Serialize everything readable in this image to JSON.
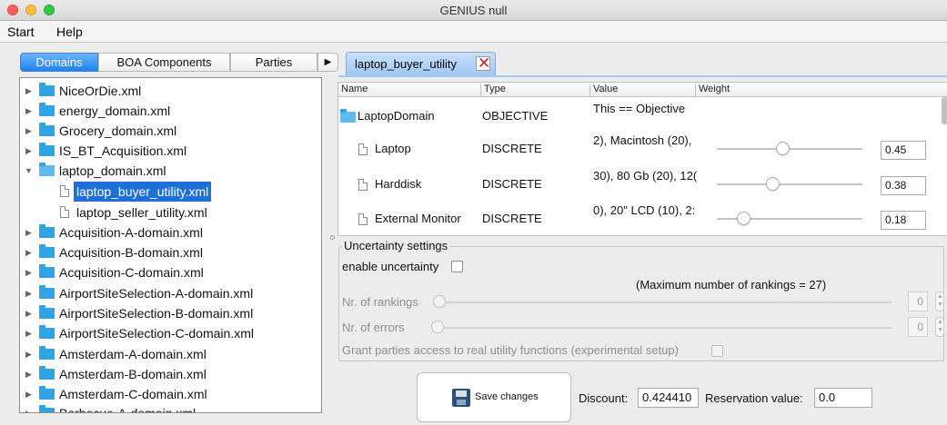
{
  "window": {
    "title": "GENIUS null"
  },
  "menu": {
    "items": [
      "Start",
      "Help"
    ]
  },
  "left_tabs": {
    "domains": "Domains",
    "boa": "BOA Components",
    "parties": "Parties",
    "more": "▶"
  },
  "tree": [
    "NiceOrDie.xml",
    "energy_domain.xml",
    "Grocery_domain.xml",
    "IS_BT_Acquisition.xml",
    "laptop_domain.xml",
    "laptop_buyer_utility.xml",
    "laptop_seller_utility.xml",
    "Acquisition-A-domain.xml",
    "Acquisition-B-domain.xml",
    "Acquisition-C-domain.xml",
    "AirportSiteSelection-A-domain.xml",
    "AirportSiteSelection-B-domain.xml",
    "AirportSiteSelection-C-domain.xml",
    "Amsterdam-A-domain.xml",
    "Amsterdam-B-domain.xml",
    "Amsterdam-C-domain.xml",
    "Barbecue-A-domain.xml"
  ],
  "editor_tab": {
    "label": "laptop_buyer_utility"
  },
  "table": {
    "headers": [
      "Name",
      "Type",
      "Value",
      "Weight"
    ],
    "rows": [
      {
        "name": "LaptopDomain",
        "type": "OBJECTIVE",
        "value": "This == Objective",
        "weight": ""
      },
      {
        "name": "Laptop",
        "type": "DISCRETE",
        "value": "2), Macintosh (20),",
        "weight": "0.45",
        "level": 0.45
      },
      {
        "name": "Harddisk",
        "type": "DISCRETE",
        "value": "30), 80 Gb (20), 12(",
        "weight": "0.38",
        "level": 0.38
      },
      {
        "name": "External Monitor",
        "type": "DISCRETE",
        "value": "0), 20\" LCD (10), 2:",
        "weight": "0.18",
        "level": 0.18
      }
    ]
  },
  "uncertainty": {
    "title": "Uncertainty settings",
    "enable_label": "enable uncertainty",
    "max_rankings": "(Maximum number of rankings = 27)",
    "rankings_label": "Nr. of rankings",
    "rankings_value": "0",
    "errors_label": "Nr. of errors",
    "errors_value": "0",
    "grant_label": "Grant parties access to real utility functions (experimental setup)"
  },
  "footer": {
    "save_label": "Save changes",
    "discount_label": "Discount:",
    "discount_value": "0.424410",
    "reservation_label": "Reservation value:",
    "reservation_value": "0.0"
  },
  "colors": {
    "selection": "#1f6fd8",
    "folder": "#2fa3e6",
    "tab_active": "#1e82f2"
  }
}
